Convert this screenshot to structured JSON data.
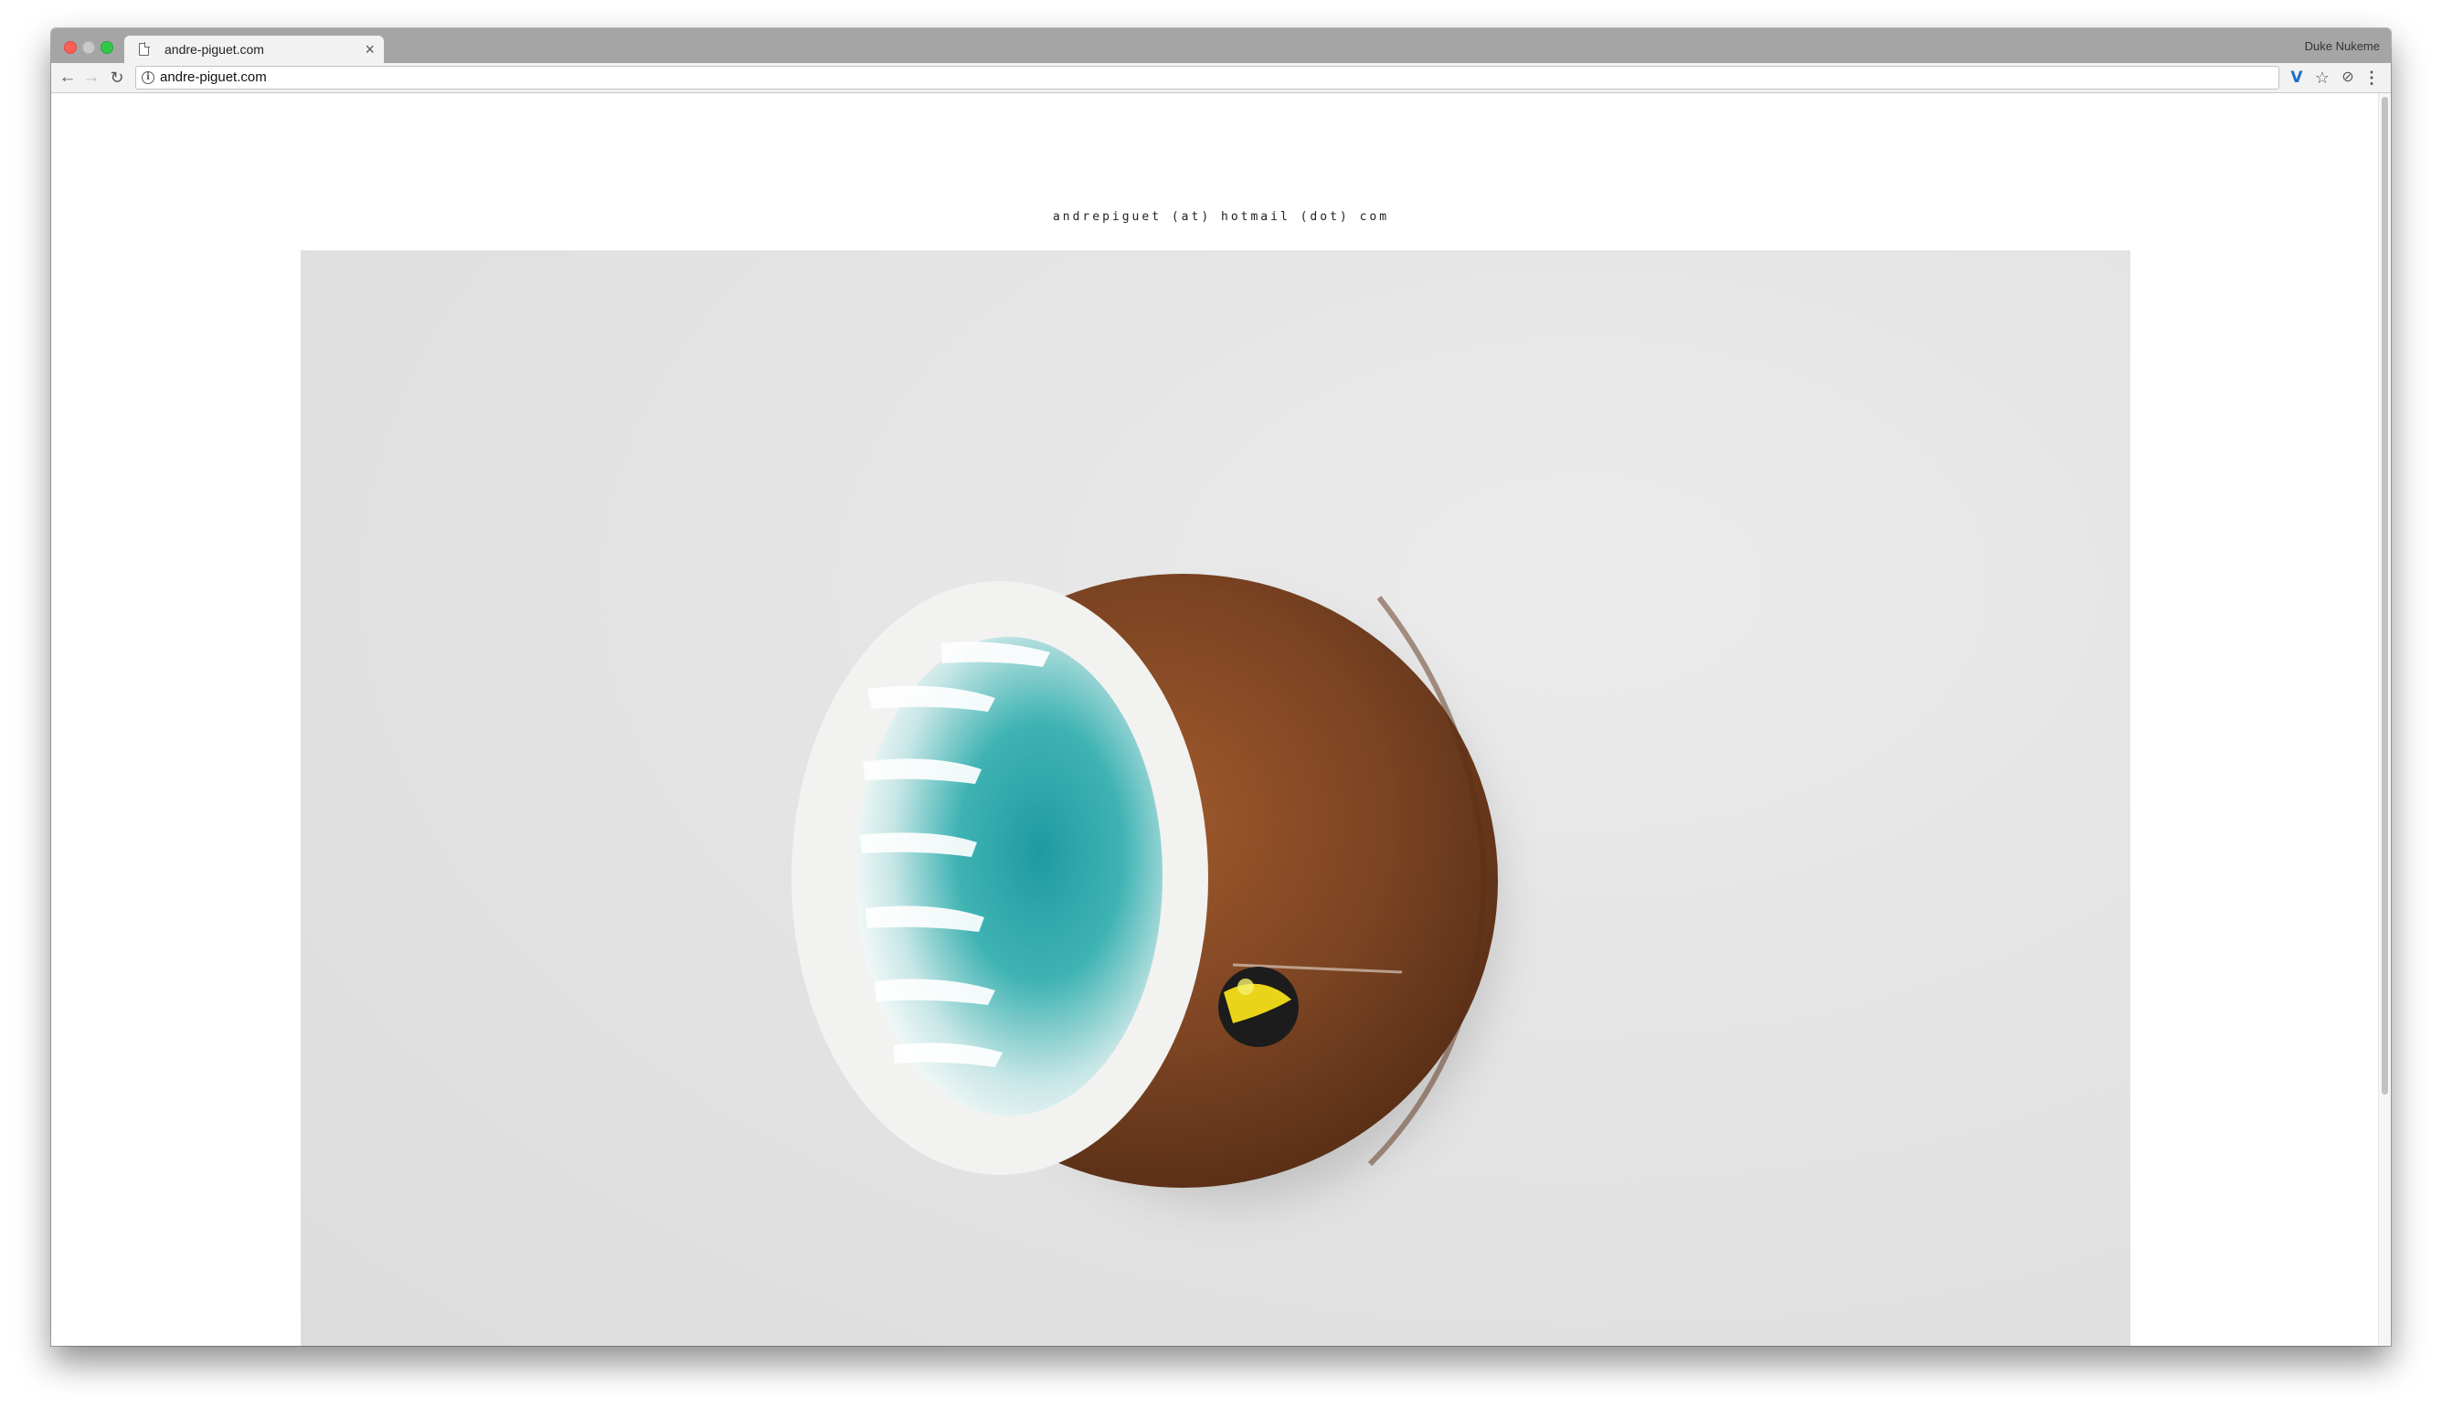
{
  "browser": {
    "tab": {
      "title": "andre-piguet.com",
      "close_glyph": "×"
    },
    "profile_name": "Duke Nukeme",
    "toolbar": {
      "back_glyph": "←",
      "forward_glyph": "→",
      "reload_glyph": "↻",
      "address": "andre-piguet.com",
      "info_glyph": "i",
      "extension_glyph": "V",
      "bookmark_glyph": "☆",
      "extension2_glyph": "⊘",
      "menu_glyph": "⋮"
    }
  },
  "page": {
    "contact_text": "andrepiguet (at) hotmail (dot) com",
    "artwork": {
      "icon": "coconut-sculpture",
      "colors": {
        "wall": "#e4e4e4",
        "shell": "#7a4322",
        "flesh": "#f2f2f0",
        "interior": "#2aa3a8"
      }
    }
  }
}
